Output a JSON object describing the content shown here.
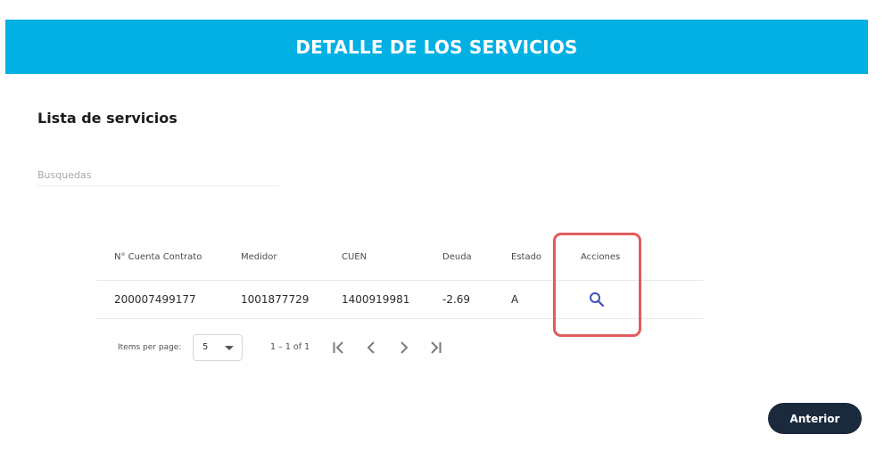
{
  "header": {
    "title": "DETALLE DE LOS SERVICIOS",
    "background_color": "#03b0e3"
  },
  "section": {
    "title": "Lista de servicios"
  },
  "search": {
    "placeholder": "Busquedas",
    "value": ""
  },
  "table": {
    "columns": [
      "N° Cuenta Contrato",
      "Medidor",
      "CUEN",
      "Deuda",
      "Estado",
      "Acciones"
    ],
    "rows": [
      {
        "cuenta_contrato": "200007499177",
        "medidor": "1001877729",
        "cuen": "1400919981",
        "deuda": "-2.69",
        "estado": "A",
        "accion_icon": "search-icon"
      }
    ]
  },
  "highlight": {
    "color": "#e35b5b"
  },
  "paginator": {
    "items_per_page_label": "Items per page:",
    "page_size": "5",
    "range_label": "1 – 1 of 1",
    "icons": [
      "first-page-icon",
      "previous-page-icon",
      "next-page-icon",
      "last-page-icon"
    ]
  },
  "actions": {
    "back_label": "Anterior",
    "back_color": "#1a2a3c"
  }
}
